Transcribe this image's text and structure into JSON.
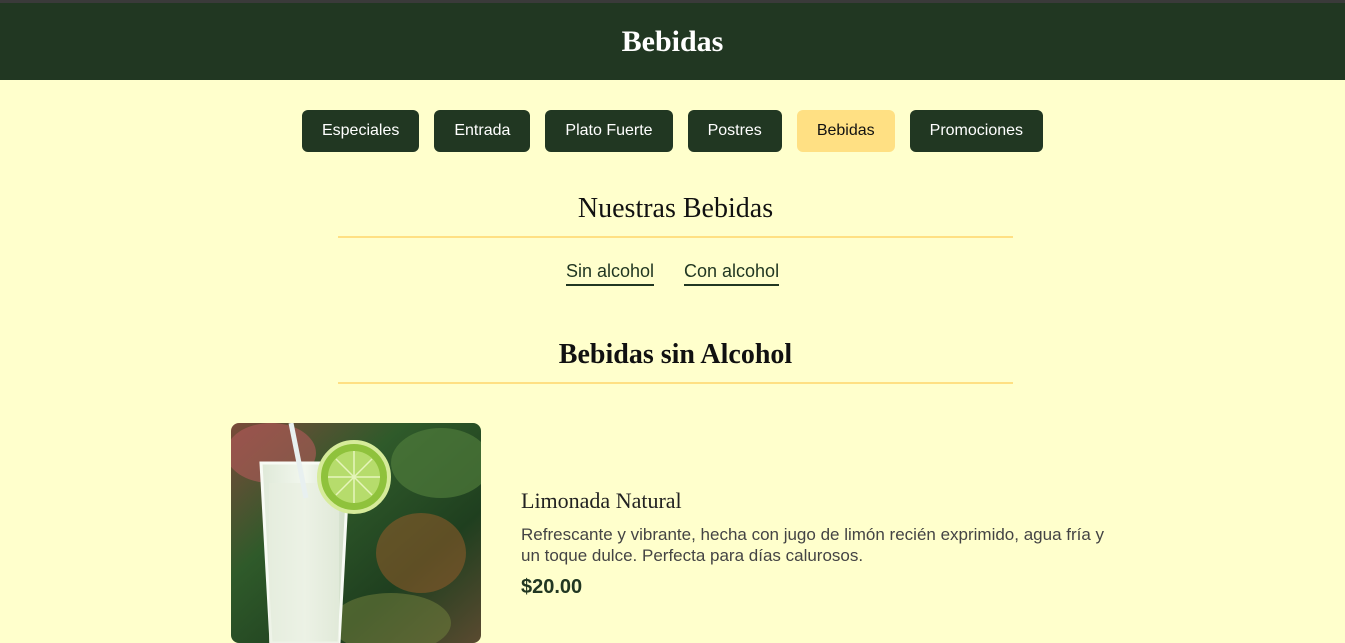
{
  "header": {
    "title": "Bebidas"
  },
  "nav": {
    "items": [
      "Especiales",
      "Entrada",
      "Plato Fuerte",
      "Postres",
      "Bebidas",
      "Promociones"
    ],
    "active": "Bebidas"
  },
  "section": {
    "title": "Nuestras Bebidas"
  },
  "subnav": {
    "items": [
      "Sin alcohol",
      "Con alcohol"
    ]
  },
  "category": {
    "title": "Bebidas sin Alcohol"
  },
  "item": {
    "name": "Limonada Natural",
    "description": "Refrescante y vibrante, hecha con jugo de limón recién exprimido, agua fría y un toque dulce. Perfecta para días calurosos.",
    "price": "$20.00"
  },
  "colors": {
    "header": "#213722",
    "background": "#ffffcc",
    "accent": "#ffe083"
  }
}
